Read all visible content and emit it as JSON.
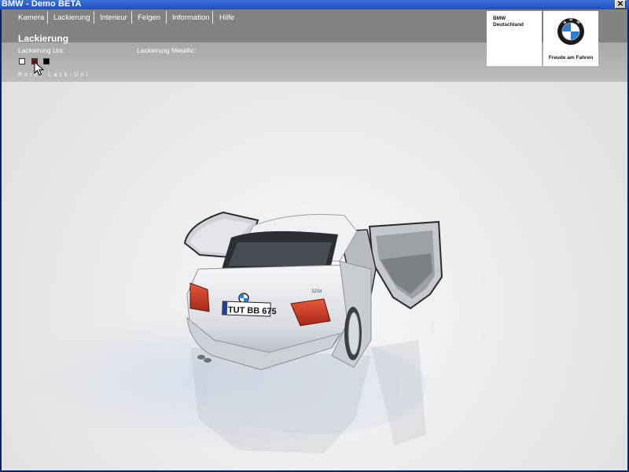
{
  "window": {
    "title": "BMW - Demo BETA",
    "close_glyph": "✕"
  },
  "nav": {
    "items": [
      "Kamera",
      "Lackierung",
      "Interieur",
      "Felgen",
      "Information",
      "Hilfe"
    ]
  },
  "panel": {
    "title": "Lackierung",
    "uni_label": "Lackierung Uni:",
    "metallic_label": "Lackierung Metallic:",
    "swatches": [
      {
        "name": "weiss",
        "color": "#f2f2f2"
      },
      {
        "name": "rot",
        "color": "#7a1020"
      },
      {
        "name": "schwarz",
        "color": "#000000"
      }
    ],
    "selected_color_name": "Roter Lack-Uni"
  },
  "brand": {
    "line1": "BMW",
    "line2": "Deutschland",
    "slogan": "Freude am Fahren",
    "roundel_letters": "BMW"
  },
  "car": {
    "plate": "TUT BB 675",
    "badge": "320d"
  },
  "colors": {
    "titlebar": "#1c4fbf",
    "menu_band": "#828282",
    "sub_band": "#b0b0b0",
    "roundel_blue": "#2a7fd4"
  }
}
